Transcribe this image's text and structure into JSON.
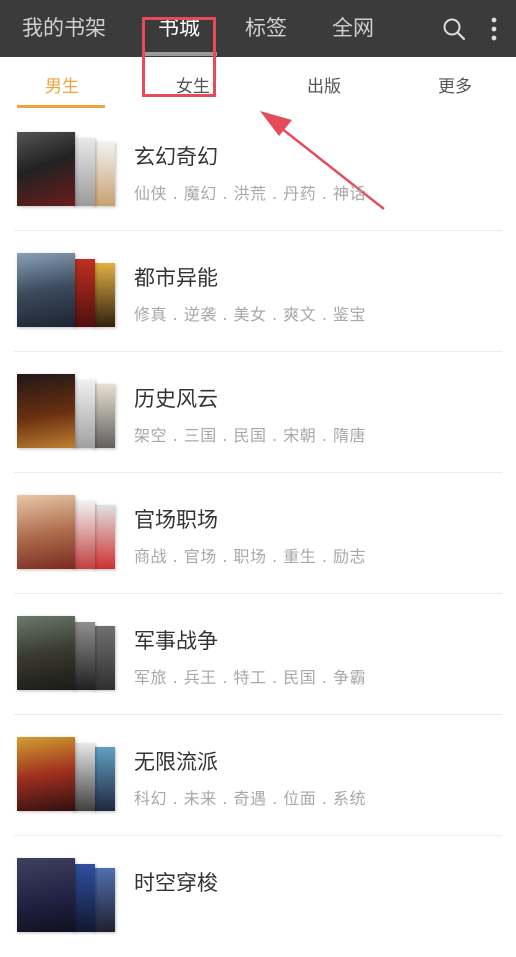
{
  "topnav": {
    "items": [
      "我的书架",
      "书城",
      "标签",
      "全网"
    ],
    "active": "书城"
  },
  "subtabs": {
    "items": [
      "男生",
      "女生",
      "出版",
      "更多"
    ],
    "active": "男生"
  },
  "categories": [
    {
      "title": "玄幻奇幻",
      "tags": "仙侠 . 魔幻 . 洪荒 . 丹药 . 神话"
    },
    {
      "title": "都市异能",
      "tags": "修真 . 逆袭 . 美女 . 爽文 . 鉴宝"
    },
    {
      "title": "历史风云",
      "tags": "架空 . 三国 . 民国 . 宋朝 . 隋唐"
    },
    {
      "title": "官场职场",
      "tags": "商战 . 官场 . 职场 . 重生 . 励志"
    },
    {
      "title": "军事战争",
      "tags": "军旅 . 兵王 . 特工 . 民国 . 争霸"
    },
    {
      "title": "无限流派",
      "tags": "科幻 . 未来 . 奇遇 . 位面 . 系统"
    },
    {
      "title": "时空穿梭",
      "tags": ""
    }
  ],
  "colors": {
    "topbar": "#3b3b3b",
    "accent": "#f0a33a",
    "annotation": "#e64b5a"
  }
}
